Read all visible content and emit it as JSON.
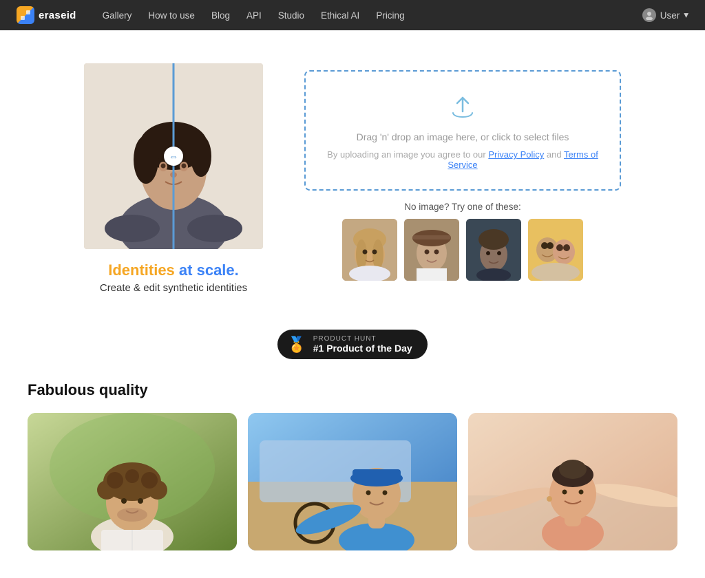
{
  "nav": {
    "logo_text": "eraseid",
    "links": [
      {
        "label": "Gallery",
        "name": "gallery"
      },
      {
        "label": "How to use",
        "name": "how-to-use"
      },
      {
        "label": "Blog",
        "name": "blog"
      },
      {
        "label": "API",
        "name": "api"
      },
      {
        "label": "Studio",
        "name": "studio"
      },
      {
        "label": "Ethical AI",
        "name": "ethical-ai"
      },
      {
        "label": "Pricing",
        "name": "pricing"
      }
    ],
    "user_label": "User"
  },
  "hero": {
    "caption_word1": "Identities",
    "caption_word2": "at scale.",
    "caption_sub": "Create & edit synthetic identities",
    "upload": {
      "main_text": "Drag 'n' drop an image here, or click to select files",
      "sub_text_prefix": "By uploading an image you agree to our ",
      "privacy_link": "Privacy Policy",
      "and_text": " and ",
      "terms_link": "Terms of Service"
    },
    "sample_label": "No image? Try one of these:"
  },
  "badge": {
    "small_text": "PRODUCT HUNT",
    "big_text": "#1 Product of the Day"
  },
  "quality": {
    "title": "Fabulous quality"
  }
}
